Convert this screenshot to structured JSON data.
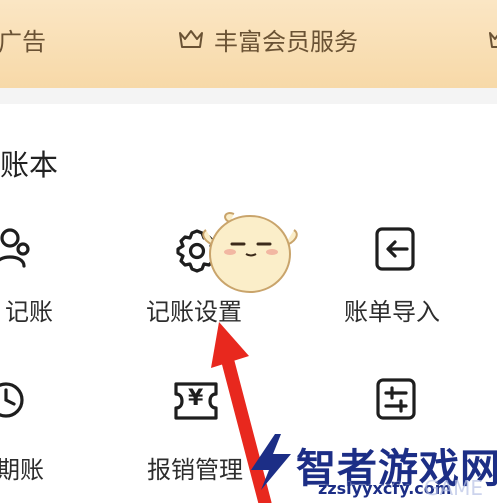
{
  "banner": {
    "left_text": "广告",
    "middle_text": "丰富会员服务",
    "icons": [
      "crown-icon",
      "crown-icon"
    ]
  },
  "section": {
    "title": "账本"
  },
  "grid": {
    "row1": [
      {
        "label": "记账",
        "icon": "users-icon"
      },
      {
        "label": "记账设置",
        "icon": "gear-icon"
      },
      {
        "label": "账单导入",
        "icon": "import-icon"
      }
    ],
    "row2": [
      {
        "label": "期账",
        "icon": "clock-icon"
      },
      {
        "label": "报销管理",
        "icon": "receipt-yen-icon",
        "icon_text": "¥"
      },
      {
        "label": "",
        "icon": "sliders-icon"
      }
    ]
  },
  "annotation": {
    "arrow_color": "#e8281e"
  },
  "watermark": {
    "title": "智者游戏网",
    "url": "zzslyyxcfy.com",
    "tag": "GAME"
  }
}
